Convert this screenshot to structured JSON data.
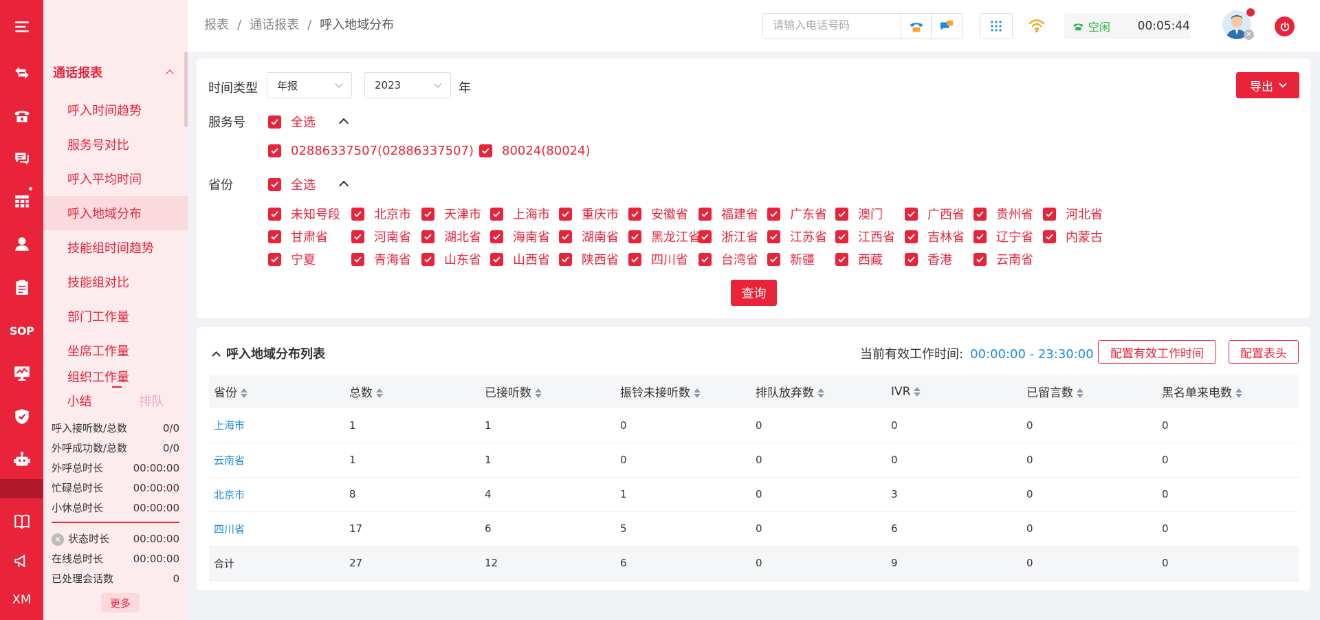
{
  "rail": {
    "sop_label": "SOP",
    "xm_label": "XM"
  },
  "sidebar": {
    "group_title": "通话报表",
    "items": [
      {
        "label": "呼入时间趋势"
      },
      {
        "label": "服务号对比"
      },
      {
        "label": "呼入平均时间"
      },
      {
        "label": "呼入地域分布"
      },
      {
        "label": "技能组时间趋势"
      },
      {
        "label": "技能组对比"
      },
      {
        "label": "部门工作量"
      },
      {
        "label": "坐席工作量"
      },
      {
        "label": "组织工作量"
      }
    ],
    "active_item": "呼入地域分布"
  },
  "summary": {
    "tab_summary": "小结",
    "tab_queue": "排队",
    "rows": [
      {
        "label": "呼入接听数/总数",
        "value": "0/0"
      },
      {
        "label": "外呼成功数/总数",
        "value": "0/0"
      },
      {
        "label": "外呼总时长",
        "value": "00:00:00"
      },
      {
        "label": "忙碌总时长",
        "value": "00:00:00"
      },
      {
        "label": "小休总时长",
        "value": "00:00:00"
      }
    ],
    "rows2": [
      {
        "label": "状态时长",
        "value": "00:00:00"
      },
      {
        "label": "在线总时长",
        "value": "00:00:00"
      },
      {
        "label": "已处理会话数",
        "value": "0"
      }
    ],
    "more": "更多"
  },
  "header": {
    "breadcrumb": [
      "报表",
      "通话报表",
      "呼入地域分布"
    ],
    "phone_placeholder": "请输入电话号码",
    "status": "空闲",
    "timer": "00:05:44"
  },
  "filters": {
    "time_type_label": "时间类型",
    "time_type_value": "年报",
    "year_value": "2023",
    "year_unit": "年",
    "export_label": "导出",
    "service_label": "服务号",
    "select_all": "全选",
    "service_numbers": [
      "02886337507(02886337507)",
      "80024(80024)"
    ],
    "province_label": "省份",
    "provinces": [
      [
        "未知号段",
        "北京市",
        "天津市",
        "上海市",
        "重庆市",
        "安徽省",
        "福建省",
        "广东省",
        "澳门",
        "广西省",
        "贵州省",
        "河北省"
      ],
      [
        "甘肃省",
        "河南省",
        "湖北省",
        "海南省",
        "湖南省",
        "黑龙江省",
        "浙江省",
        "江苏省",
        "江西省",
        "吉林省",
        "辽宁省",
        "内蒙古"
      ],
      [
        "宁夏",
        "青海省",
        "山东省",
        "山西省",
        "陕西省",
        "四川省",
        "台湾省",
        "新疆",
        "西藏",
        "香港",
        "云南省"
      ]
    ],
    "query_label": "查询"
  },
  "list": {
    "title": "呼入地域分布列表",
    "worktime_label": "当前有效工作时间:",
    "worktime_value": "00:00:00 - 23:30:00",
    "config_time_btn": "配置有效工作时间",
    "config_header_btn": "配置表头",
    "columns": [
      "省份",
      "总数",
      "已接听数",
      "振铃未接听数",
      "排队放弃数",
      "IVR",
      "已留言数",
      "黑名单来电数"
    ],
    "rows": [
      [
        "上海市",
        "1",
        "1",
        "0",
        "0",
        "0",
        "0",
        "0"
      ],
      [
        "云南省",
        "1",
        "1",
        "0",
        "0",
        "0",
        "0",
        "0"
      ],
      [
        "北京市",
        "8",
        "4",
        "1",
        "0",
        "3",
        "0",
        "0"
      ],
      [
        "四川省",
        "17",
        "6",
        "5",
        "0",
        "6",
        "0",
        "0"
      ]
    ],
    "total_row": [
      "合计",
      "27",
      "12",
      "6",
      "0",
      "9",
      "0",
      "0"
    ]
  },
  "colors": {
    "brand": "#e8233a",
    "link": "#1a8ae6",
    "status_idle": "#2bb34a"
  }
}
